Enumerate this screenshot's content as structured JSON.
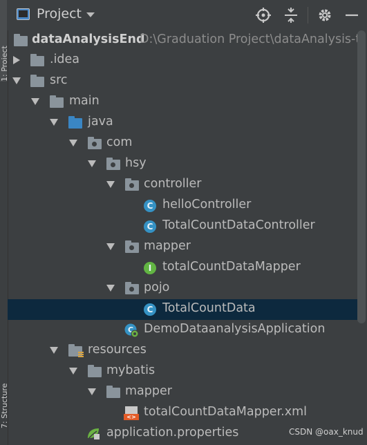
{
  "side_tabs": {
    "project": "1: Project",
    "structure": "7: Structure"
  },
  "header": {
    "title": "Project"
  },
  "toolbar": {
    "locate": "crosshair-icon",
    "collapse": "collapse-icon",
    "settings": "gear-icon",
    "hide": "minimize-icon"
  },
  "tree": {
    "root": {
      "name": "dataAnalysisEnd",
      "path": "D:\\Graduation Project\\dataAnalysis-to"
    },
    "idea": ".idea",
    "src": "src",
    "main": "main",
    "java": "java",
    "com": "com",
    "hsy": "hsy",
    "controller": "controller",
    "helloController": "helloController",
    "totalCountDataController": "TotalCountDataController",
    "mapper": "mapper",
    "totalCountDataMapper": "totalCountDataMapper",
    "pojo": "pojo",
    "totalCountData": "TotalCountData",
    "application": "DemoDataanalysisApplication",
    "resources": "resources",
    "mybatis": "mybatis",
    "mybatisMapper": "mapper",
    "mapperXml": "totalCountDataMapper.xml",
    "properties": "application.properties"
  },
  "icons": {
    "class_letter": "C",
    "interface_letter": "I",
    "xml_tag": "<>"
  },
  "watermark": "CSDN @oax_knud",
  "colors": {
    "background": "#3c3f41",
    "selection": "#0d293e",
    "class_icon": "#3592c4",
    "interface_icon": "#62b543",
    "source_folder": "#3a86c4"
  }
}
